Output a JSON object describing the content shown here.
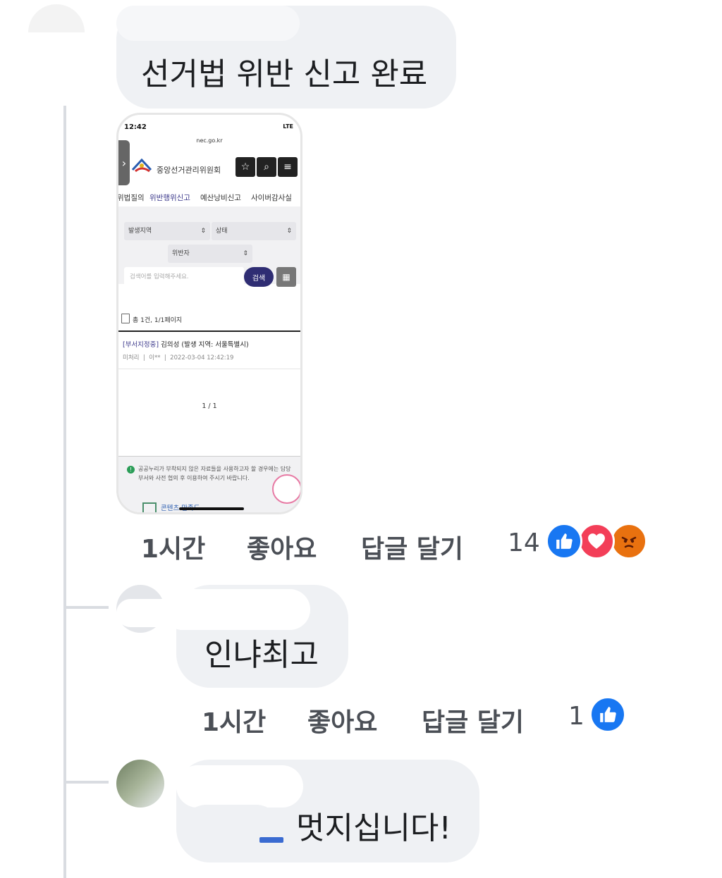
{
  "comments": [
    {
      "text": "선거법 위반 신고 완료",
      "meta": {
        "time": "1시간",
        "like": "좋아요",
        "reply": "답글 달기"
      },
      "reactions": {
        "count": "14",
        "types": [
          "like-icon",
          "love-icon",
          "angry-icon"
        ]
      },
      "attachment": {
        "status": {
          "time": "12:42",
          "network": "LTE"
        },
        "url": "nec.go.kr",
        "site_title": "중앙선거관리위원회",
        "tabs": [
          "위법질의",
          "위반행위신고",
          "예산낭비신고",
          "사이버감사실"
        ],
        "active_tab": 1,
        "filters": {
          "region": "발생지역",
          "status": "상태",
          "violator": "위반자"
        },
        "search": {
          "placeholder": "검색어를 입력해주세요.",
          "button": "검색"
        },
        "total": "총 1건, 1/1페이지",
        "item": {
          "tag": "[부서지정중]",
          "title": "김의성 (발생 지역: 서울특별시)",
          "state": "미처리",
          "author": "이**",
          "date": "2022-03-04 12:42:19"
        },
        "pagination": "1 / 1",
        "notice": "공공누리가 부착되지 않은 자료들을 사용하고자 할 경우에는 담당부서와 사전 협의 후 이용하여 주시기 바랍니다.",
        "content_link": "콘텐츠 만족도"
      }
    },
    {
      "text": "인냐최고",
      "meta": {
        "time": "1시간",
        "like": "좋아요",
        "reply": "답글 달기"
      },
      "reactions": {
        "count": "1",
        "types": [
          "like-icon"
        ]
      }
    },
    {
      "text": "멋지십니다!"
    }
  ],
  "colors": {
    "like": "#1877f2",
    "love": "#f33e58",
    "angry": "#e9710f",
    "bubble": "#eff1f4",
    "thread": "#d9dce1"
  }
}
